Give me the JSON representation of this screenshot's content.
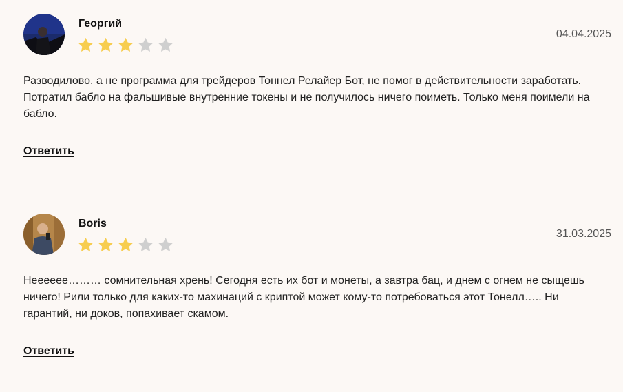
{
  "reviews": [
    {
      "author": "Георгий",
      "date": "04.04.2025",
      "rating": 3,
      "max_rating": 5,
      "text": "Разводилово, а не программа для трейдеров Тоннел Релайер Бот, не помог в действительности заработать. Потратил бабло на фальшивые внутренние токены и не получилось ничего поиметь. Только меня поимели на бабло.",
      "reply_label": "Ответить"
    },
    {
      "author": "Boris",
      "date": "31.03.2025",
      "rating": 3,
      "max_rating": 5,
      "text": "Неееееe……… сомнительная хрень! Сегодня есть их бот и монеты, а завтра бац, и днем с огнем не сыщешь ничего! Рили только для каких-то махинаций с криптой может кому-то потребоваться этот Тонелл….. Ни гарантий, ни доков, попахивает скамом.",
      "reply_label": "Ответить"
    }
  ],
  "colors": {
    "star_filled": "#f7cd4f",
    "star_empty": "#cfcfcf",
    "background": "#fcf8f5"
  }
}
